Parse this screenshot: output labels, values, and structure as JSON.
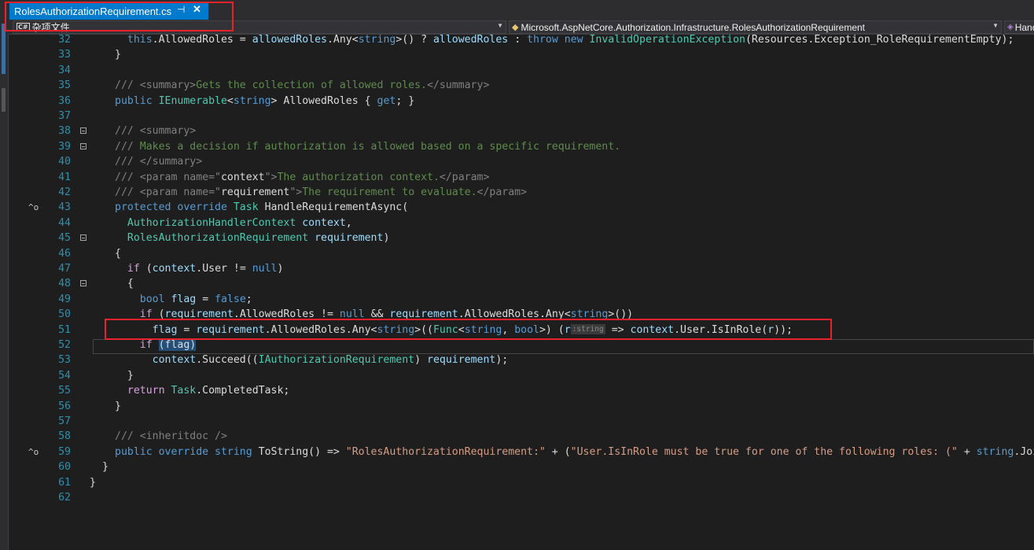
{
  "editor_tab": {
    "file_name": "RolesAuthorizationRequirement.cs",
    "pin_glyph": "⊣",
    "close_glyph": "✕"
  },
  "navigation_bar": {
    "project_icon": "C#",
    "project_label": "杂项文件",
    "type_label": "Microsoft.AspNetCore.Authorization.Infrastructure.RolesAuthorizationRequirement",
    "member_label": "HandleRequirementAsync"
  },
  "colors": {
    "tab_active": "#007acc",
    "editor_background": "#1e1e1e",
    "line_numbers": "#2b91af",
    "keyword": "#569cd6",
    "type": "#4ec9b0",
    "comment": "#57a64a",
    "string": "#d69d85",
    "highlight_border": "#e8212a"
  },
  "code_lines": [
    {
      "n": "32",
      "parts": [
        [
          "pl",
          "  "
        ],
        [
          "kw",
          "this"
        ],
        [
          "pl",
          ".AllowedRoles = "
        ],
        [
          "id",
          "allowedRoles"
        ],
        [
          "pl",
          ".Any<"
        ],
        [
          "kw",
          "string"
        ],
        [
          "pl",
          ">() ? "
        ],
        [
          "id",
          "allowedRoles"
        ],
        [
          "pl",
          " : "
        ],
        [
          "kw",
          "throw new "
        ],
        [
          "ty",
          "InvalidOperationException"
        ],
        [
          "pl",
          "(Resources.Exception_RoleRequirementEmpty);"
        ]
      ]
    },
    {
      "n": "33",
      "parts": [
        [
          "pl",
          "}"
        ]
      ]
    },
    {
      "n": "34",
      "parts": []
    },
    {
      "n": "35",
      "parts": [
        [
          "dg",
          "/// <summary>"
        ],
        [
          "dc",
          "Gets the collection of allowed roles."
        ],
        [
          "dg",
          "</summary>"
        ]
      ]
    },
    {
      "n": "36",
      "parts": [
        [
          "kw",
          "public "
        ],
        [
          "ty",
          "IEnumerable"
        ],
        [
          "pl",
          "<"
        ],
        [
          "kw",
          "string"
        ],
        [
          "pl",
          "> AllowedRoles { "
        ],
        [
          "kw",
          "get"
        ],
        [
          "pl",
          "; }"
        ]
      ]
    },
    {
      "n": "37",
      "parts": []
    },
    {
      "n": "38",
      "parts": [
        [
          "dg",
          "/// <summary>"
        ]
      ]
    },
    {
      "n": "39",
      "parts": [
        [
          "dg",
          "/// "
        ],
        [
          "dc",
          "Makes a decision if authorization is allowed based on a specific requirement."
        ]
      ]
    },
    {
      "n": "40",
      "parts": [
        [
          "dg",
          "/// </summary>"
        ]
      ]
    },
    {
      "n": "41",
      "parts": [
        [
          "dg",
          "/// <param name=\""
        ],
        [
          "pl",
          "context"
        ],
        [
          "dg",
          "\">"
        ],
        [
          "dc",
          "The authorization context."
        ],
        [
          "dg",
          "</param>"
        ]
      ]
    },
    {
      "n": "42",
      "parts": [
        [
          "dg",
          "/// <param name=\""
        ],
        [
          "pl",
          "requirement"
        ],
        [
          "dg",
          "\">"
        ],
        [
          "dc",
          "The requirement to evaluate."
        ],
        [
          "dg",
          "</param>"
        ]
      ]
    },
    {
      "n": "43",
      "parts": [
        [
          "kw",
          "protected override "
        ],
        [
          "ty",
          "Task"
        ],
        [
          "pl",
          " HandleRequirementAsync("
        ]
      ]
    },
    {
      "n": "44",
      "parts": [
        [
          "pl",
          "  "
        ],
        [
          "ty",
          "AuthorizationHandlerContext"
        ],
        [
          "pl",
          " "
        ],
        [
          "id",
          "context"
        ],
        [
          "pl",
          ","
        ]
      ]
    },
    {
      "n": "45",
      "parts": [
        [
          "pl",
          "  "
        ],
        [
          "ty",
          "RolesAuthorizationRequirement"
        ],
        [
          "pl",
          " "
        ],
        [
          "id",
          "requirement"
        ],
        [
          "pl",
          ")"
        ]
      ]
    },
    {
      "n": "46",
      "parts": [
        [
          "pl",
          "{"
        ]
      ]
    },
    {
      "n": "47",
      "parts": [
        [
          "pl",
          "  "
        ],
        [
          "kw2",
          "if"
        ],
        [
          "pl",
          " ("
        ],
        [
          "id",
          "context"
        ],
        [
          "pl",
          ".User != "
        ],
        [
          "kw",
          "null"
        ],
        [
          "pl",
          ")"
        ]
      ]
    },
    {
      "n": "48",
      "parts": [
        [
          "pl",
          "  {"
        ]
      ]
    },
    {
      "n": "49",
      "parts": [
        [
          "pl",
          "    "
        ],
        [
          "kw",
          "bool"
        ],
        [
          "pl",
          " "
        ],
        [
          "id",
          "flag"
        ],
        [
          "pl",
          " = "
        ],
        [
          "kw",
          "false"
        ],
        [
          "pl",
          ";"
        ]
      ]
    },
    {
      "n": "50",
      "parts": [
        [
          "pl",
          "    "
        ],
        [
          "kw2",
          "if"
        ],
        [
          "pl",
          " ("
        ],
        [
          "id",
          "requirement"
        ],
        [
          "pl",
          ".AllowedRoles != "
        ],
        [
          "kw",
          "null"
        ],
        [
          "pl",
          " && "
        ],
        [
          "id",
          "requirement"
        ],
        [
          "pl",
          ".AllowedRoles.Any<"
        ],
        [
          "kw",
          "string"
        ],
        [
          "pl",
          ">())"
        ]
      ]
    },
    {
      "n": "51",
      "parts": [
        [
          "pl",
          "      "
        ],
        [
          "id",
          "flag"
        ],
        [
          "pl",
          " = "
        ],
        [
          "id",
          "requirement"
        ],
        [
          "pl",
          ".AllowedRoles.Any<"
        ],
        [
          "kw",
          "string"
        ],
        [
          "pl",
          ">(("
        ],
        [
          "ty",
          "Func"
        ],
        [
          "pl",
          "<"
        ],
        [
          "kw",
          "string"
        ],
        [
          "pl",
          ", "
        ],
        [
          "kw",
          "bool"
        ],
        [
          "pl",
          ">) ("
        ],
        [
          "id",
          "r"
        ],
        [
          "hint",
          ":string"
        ],
        [
          "pl",
          " => "
        ],
        [
          "id",
          "context"
        ],
        [
          "pl",
          ".User.IsInRole("
        ],
        [
          "id",
          "r"
        ],
        [
          "pl",
          "));"
        ]
      ]
    },
    {
      "n": "52",
      "parts": [
        [
          "pl",
          "    "
        ],
        [
          "kw2",
          "if"
        ],
        [
          "pl",
          " "
        ],
        [
          "sel",
          "(flag)"
        ]
      ]
    },
    {
      "n": "53",
      "parts": [
        [
          "pl",
          "      "
        ],
        [
          "id",
          "context"
        ],
        [
          "pl",
          ".Succeed(("
        ],
        [
          "ty",
          "IAuthorizationRequirement"
        ],
        [
          "pl",
          ") "
        ],
        [
          "id",
          "requirement"
        ],
        [
          "pl",
          ");"
        ]
      ]
    },
    {
      "n": "54",
      "parts": [
        [
          "pl",
          "  }"
        ]
      ]
    },
    {
      "n": "55",
      "parts": [
        [
          "pl",
          "  "
        ],
        [
          "kw2",
          "return "
        ],
        [
          "ty",
          "Task"
        ],
        [
          "pl",
          ".CompletedTask;"
        ]
      ]
    },
    {
      "n": "56",
      "parts": [
        [
          "pl",
          "}"
        ]
      ]
    },
    {
      "n": "57",
      "parts": []
    },
    {
      "n": "58",
      "parts": [
        [
          "dg",
          "/// <inheritdoc />"
        ]
      ]
    },
    {
      "n": "59",
      "parts": [
        [
          "kw",
          "public override string "
        ],
        [
          "pl",
          "ToString() => "
        ],
        [
          "st",
          "\"RolesAuthorizationRequirement:\""
        ],
        [
          "pl",
          " + ("
        ],
        [
          "st",
          "\"User.IsInRole must be true for one of the following roles: (\""
        ],
        [
          "pl",
          " + "
        ],
        [
          "kw",
          "string"
        ],
        [
          "pl",
          ".Join"
        ]
      ]
    },
    {
      "n": "60",
      "parts": [
        [
          "pl",
          "}"
        ]
      ]
    },
    {
      "n": "61",
      "parts": [
        [
          "pl",
          "}"
        ]
      ]
    },
    {
      "n": "62",
      "parts": []
    }
  ]
}
